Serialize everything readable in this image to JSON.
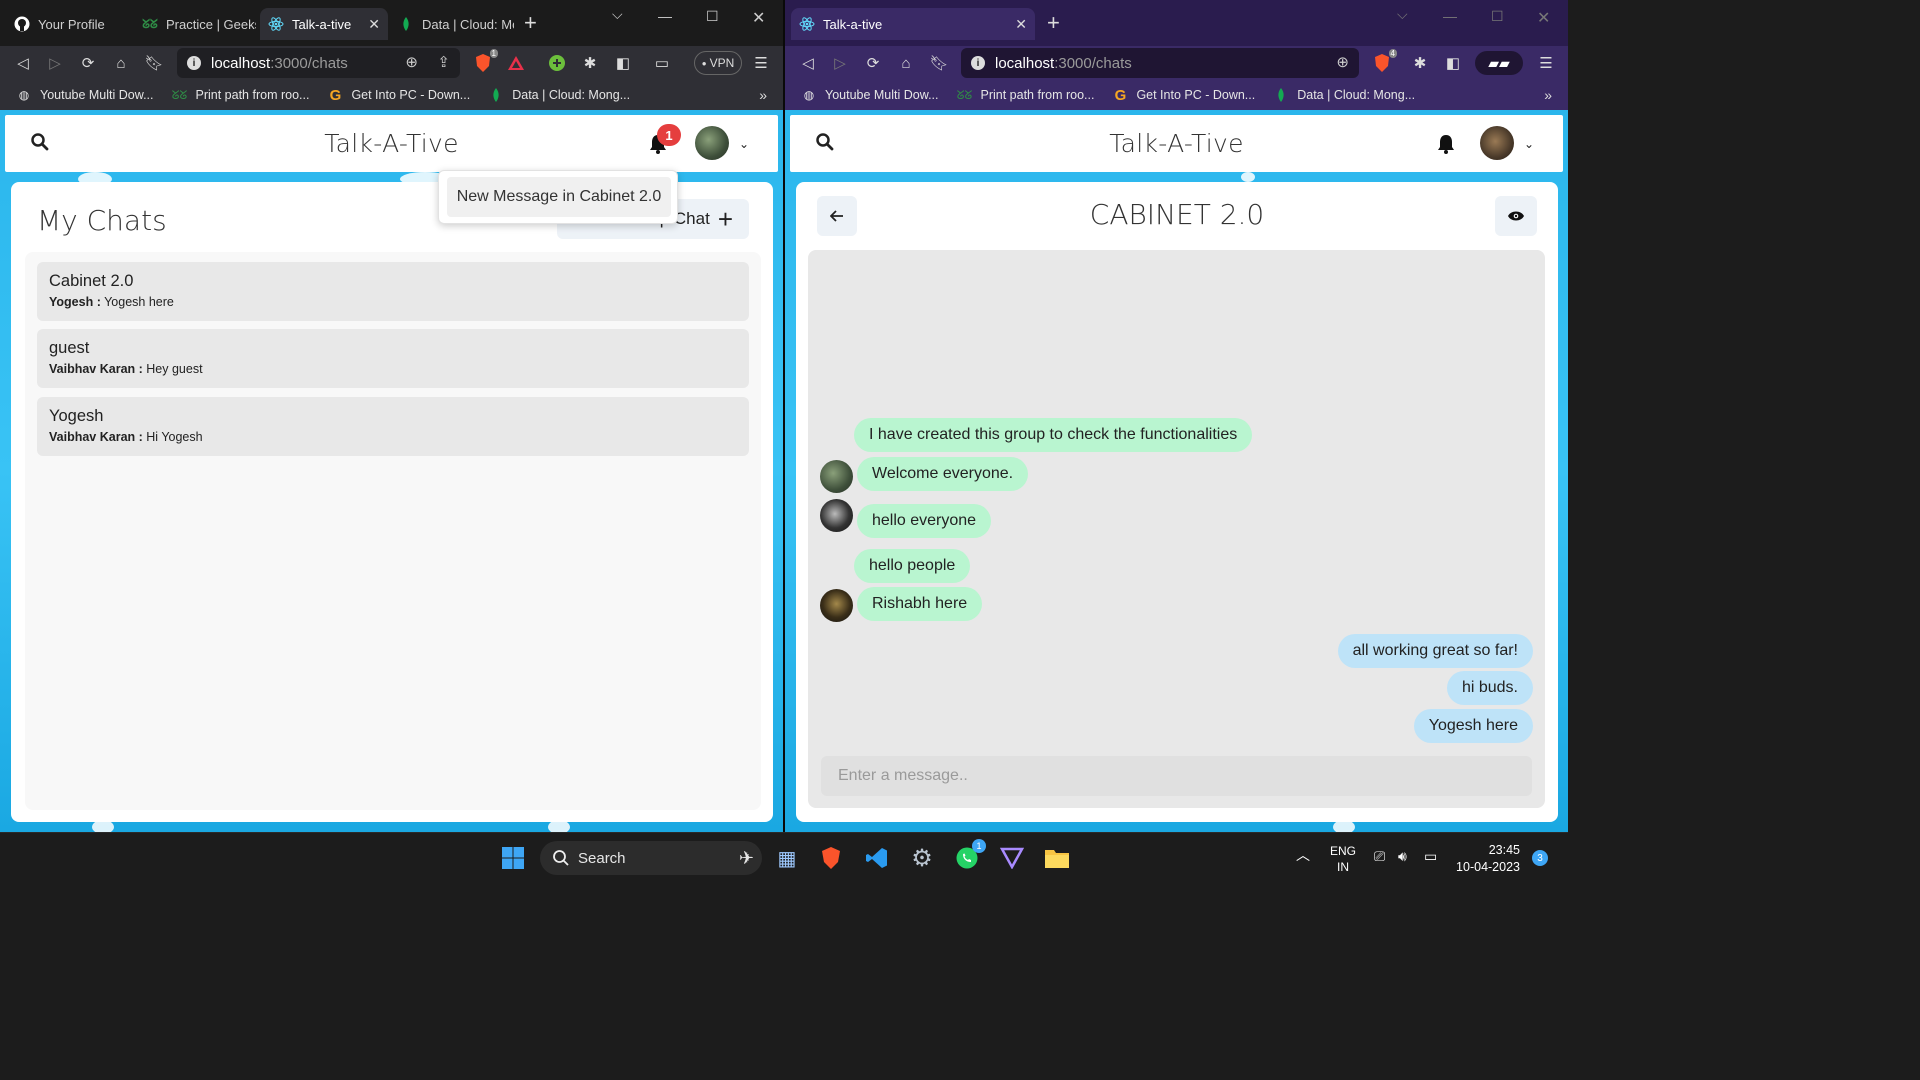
{
  "left_browser": {
    "tabs": [
      {
        "label": "Your Profile",
        "icon": "github-icon"
      },
      {
        "label": "Practice | Geeksf",
        "icon": "geeksforgeeks-icon"
      },
      {
        "label": "Talk-a-tive",
        "icon": "react-icon",
        "active": true
      },
      {
        "label": "Data | Cloud: Mc",
        "icon": "mongodb-icon"
      }
    ],
    "url_host": "localhost",
    "url_path": ":3000/chats",
    "vpn_label": "VPN",
    "brave_badge": "1"
  },
  "right_browser": {
    "tabs": [
      {
        "label": "Talk-a-tive",
        "icon": "react-icon",
        "active": true
      }
    ],
    "url_host": "localhost",
    "url_path": ":3000/chats",
    "brave_badge": "4"
  },
  "bookmarks": [
    {
      "label": "Youtube Multi Dow...",
      "icon": "globe-icon"
    },
    {
      "label": "Print path from roo...",
      "icon": "geeksforgeeks-icon"
    },
    {
      "label": "Get Into PC - Down...",
      "icon": "g-icon"
    },
    {
      "label": "Data | Cloud: Mong...",
      "icon": "mongodb-icon"
    }
  ],
  "app": {
    "title": "Talk-A-Tive",
    "notification_count": "1"
  },
  "left_app": {
    "my_chats_title": "My Chats",
    "new_group_label": "New Group Chat",
    "notification_popup": "New Message in Cabinet 2.0",
    "chats": [
      {
        "name": "Cabinet 2.0",
        "sender": "Yogesh :",
        "message": " Yogesh here"
      },
      {
        "name": "guest",
        "sender": "Vaibhav Karan :",
        "message": " Hey guest"
      },
      {
        "name": "Yogesh",
        "sender": "Vaibhav Karan :",
        "message": " Hi Yogesh"
      }
    ]
  },
  "right_app": {
    "chat_title": "CABINET 2.0",
    "messages": [
      {
        "text": "I have created this group to check the functionalities",
        "side": "in"
      },
      {
        "text": "Welcome everyone.",
        "side": "in"
      },
      {
        "text": "hello everyone",
        "side": "in"
      },
      {
        "text": "hello people",
        "side": "in"
      },
      {
        "text": "Rishabh here",
        "side": "in"
      },
      {
        "text": "all working great so far!",
        "side": "out"
      },
      {
        "text": "hi buds.",
        "side": "out"
      },
      {
        "text": "Yogesh here",
        "side": "out"
      }
    ],
    "input_placeholder": "Enter a message.."
  },
  "taskbar": {
    "search_label": "Search",
    "lang_top": "ENG",
    "lang_bottom": "IN",
    "time": "23:45",
    "date": "10-04-2023",
    "notification_count": "3",
    "whatsapp_badge": "1"
  },
  "colors": {
    "page_bg": "#39c3f5",
    "incoming_bubble": "#b9f5d0",
    "outgoing_bubble": "#bee3f8",
    "badge_red": "#e53e3e"
  }
}
